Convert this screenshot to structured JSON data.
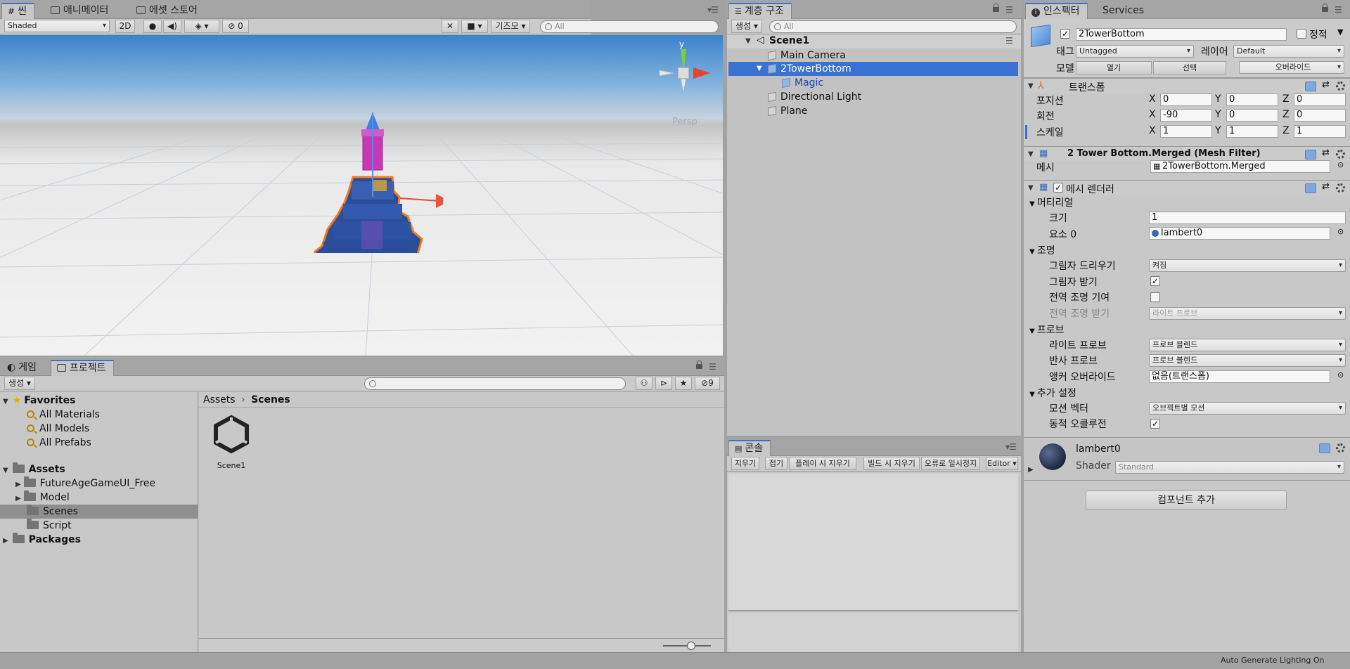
{
  "scene": {
    "tabs": [
      {
        "label": "씬"
      },
      {
        "label": "애니메이터"
      },
      {
        "label": "에셋 스토어"
      }
    ],
    "toolbar": {
      "shading": "Shaded",
      "mode2d": "2D",
      "hidden_count": "0",
      "gizmo": "기즈모",
      "search_placeholder": "All"
    },
    "persp": "Persp",
    "axis_y": "y"
  },
  "hierarchy": {
    "tab": "계층 구조",
    "create": "생성",
    "search_placeholder": "All",
    "scene": "Scene1",
    "items": [
      {
        "label": "Main Camera"
      },
      {
        "label": "2TowerBottom"
      },
      {
        "label": "Magic"
      },
      {
        "label": "Directional Light"
      },
      {
        "label": "Plane"
      }
    ]
  },
  "console": {
    "tab": "콘솔",
    "buttons": [
      "지우기",
      "접기",
      "플레이 시 지우기",
      "빌드 시 지우기",
      "오류로 일시정지"
    ],
    "editor": "Editor"
  },
  "inspector": {
    "tabs": [
      {
        "label": "인스펙터"
      },
      {
        "label": "Services"
      }
    ],
    "object_name": "2TowerBottom",
    "static_label": "정적",
    "tag_label": "태그",
    "tag_value": "Untagged",
    "layer_label": "레이어",
    "layer_value": "Default",
    "model_label": "모델",
    "open": "열기",
    "select": "선택",
    "override": "오버라이드",
    "transform": {
      "title": "트랜스폼",
      "position_label": "포지션",
      "rotation_label": "회전",
      "scale_label": "스케일",
      "x": "X",
      "y": "Y",
      "z": "Z",
      "position": [
        "0",
        "0",
        "0"
      ],
      "rotation": [
        "-90",
        "0",
        "0"
      ],
      "scale": [
        "1",
        "1",
        "1"
      ]
    },
    "mesh_filter": {
      "title": "2 Tower Bottom.Merged (Mesh Filter)",
      "mesh_label": "메시",
      "mesh_value": "2TowerBottom.Merged"
    },
    "mesh_renderer": {
      "title": "메시 렌더러",
      "materials": "머티리얼",
      "size_label": "크기",
      "size_value": "1",
      "element_label": "요소 0",
      "element_value": "lambert0",
      "lighting": "조명",
      "cast_shadows_label": "그림자 드리우기",
      "cast_shadows_value": "켜짐",
      "receive_shadows_label": "그림자 받기",
      "contribute_gi_label": "전역 조명 기여",
      "receive_gi_label": "전역 조명 받기",
      "receive_gi_value": "라이트 프로브",
      "probes": "프로브",
      "light_probes_label": "라이트 프로브",
      "light_probes_value": "프로브 블렌드",
      "reflection_probes_label": "반사 프로브",
      "reflection_probes_value": "프로브 블렌드",
      "anchor_label": "앵커 오버라이드",
      "anchor_value": "없음(트랜스폼)",
      "additional": "추가 설정",
      "motion_label": "모션 벡터",
      "motion_value": "오브젝트별 모션",
      "dynamic_occlusion_label": "동적 오클루전"
    },
    "material": {
      "name": "lambert0",
      "shader_label": "Shader",
      "shader_value": "Standard"
    },
    "add_component": "컴포넌트 추가"
  },
  "project": {
    "tabs": [
      {
        "label": "게임"
      },
      {
        "label": "프로젝트"
      }
    ],
    "create": "생성",
    "hidden_count": "9",
    "favorites": "Favorites",
    "fav_items": [
      "All Materials",
      "All Models",
      "All Prefabs"
    ],
    "assets": "Assets",
    "asset_items": [
      "FutureAgeGameUI_Free",
      "Model",
      "Scenes",
      "Script"
    ],
    "packages": "Packages",
    "breadcrumb": [
      "Assets",
      "Scenes"
    ],
    "file": "Scene1"
  },
  "status": {
    "text": "Auto Generate Lighting On"
  }
}
